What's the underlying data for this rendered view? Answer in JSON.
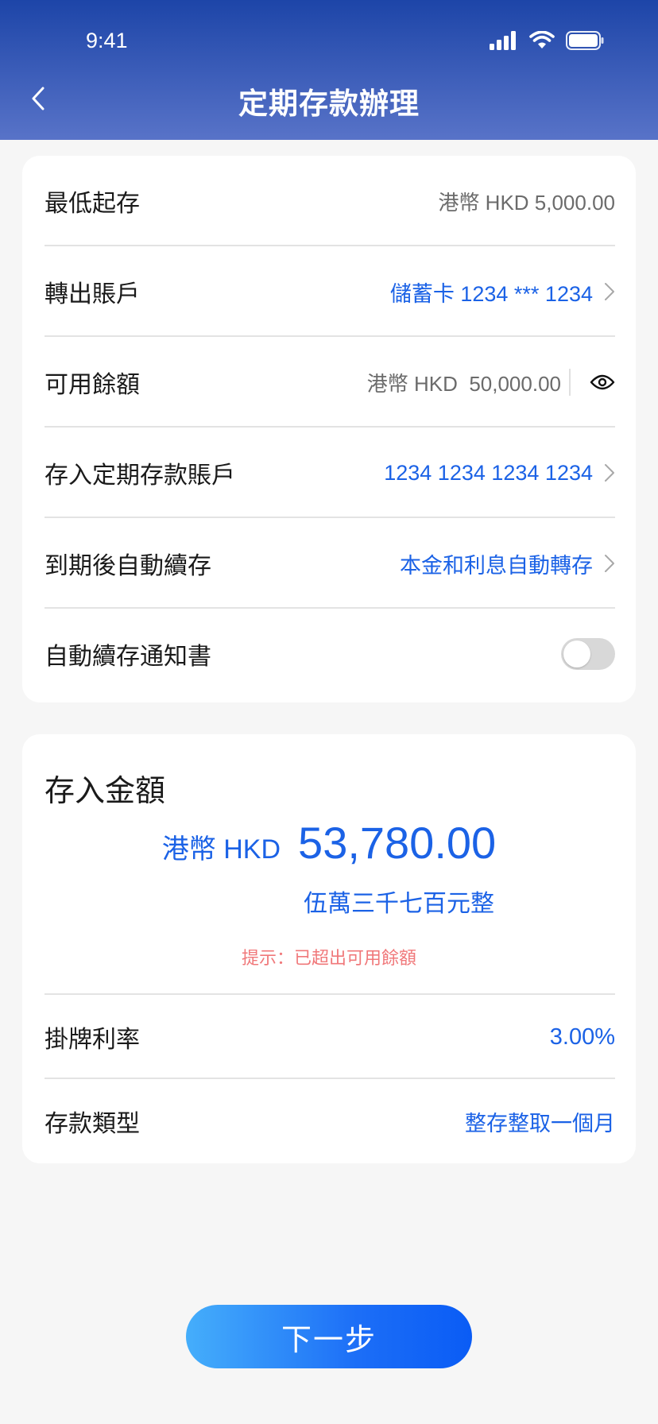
{
  "status_bar": {
    "time": "9:41"
  },
  "header": {
    "title": "定期存款辦理"
  },
  "details": {
    "min_deposit": {
      "label": "最低起存",
      "value": "港幣 HKD 5,000.00"
    },
    "transfer_account": {
      "label": "轉出賬戶",
      "value": "儲蓄卡 1234 *** 1234"
    },
    "available_balance": {
      "label": "可用餘額",
      "value": "港幣 HKD  50,000.00"
    },
    "deposit_account": {
      "label": "存入定期存款賬戶",
      "value": "1234 1234 1234 1234"
    },
    "auto_renew": {
      "label": "到期後自動續存",
      "value": "本金和利息自動轉存"
    },
    "renewal_notice": {
      "label": "自動續存通知書",
      "enabled": false
    }
  },
  "amount": {
    "title": "存入金額",
    "currency": "港幣 HKD",
    "value": "53,780.00",
    "in_words": "伍萬三千七百元整",
    "hint": "提示：已超出可用餘額"
  },
  "rate": {
    "label": "掛牌利率",
    "value": "3.00%"
  },
  "deposit_type": {
    "label": "存款類型",
    "value": "整存整取一個月"
  },
  "next_button": {
    "label": "下一步"
  },
  "colors": {
    "accent": "#1b62e6",
    "header_top": "#1d45a8",
    "header_bottom": "#5873c8",
    "warning": "#f0787a"
  }
}
